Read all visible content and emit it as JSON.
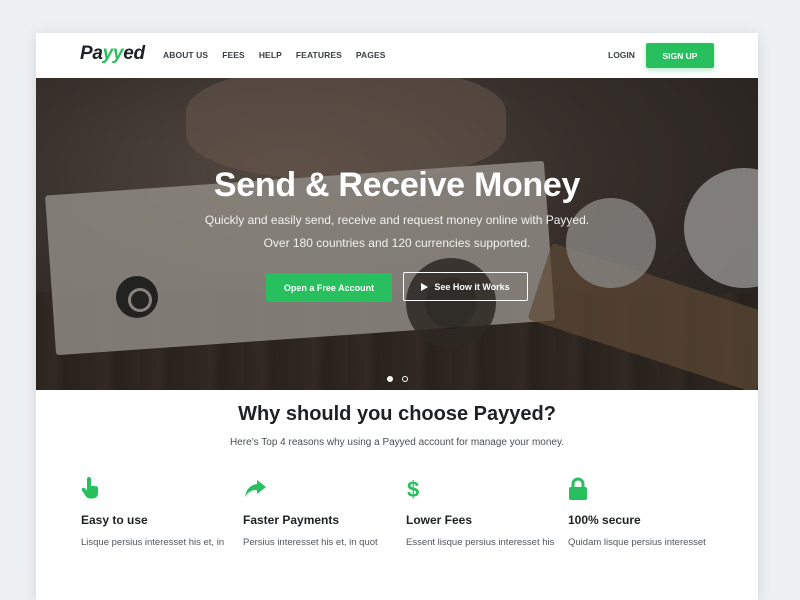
{
  "brand": {
    "logo_prefix": "Pa",
    "logo_accent": "yy",
    "logo_suffix": "ed",
    "accent_color": "#28c05f"
  },
  "nav": {
    "items": [
      {
        "label": "ABOUT US"
      },
      {
        "label": "FEES"
      },
      {
        "label": "HELP"
      },
      {
        "label": "FEATURES"
      },
      {
        "label": "PAGES"
      }
    ],
    "login_label": "LOGIN",
    "signup_label": "SIGN UP"
  },
  "hero": {
    "title": "Send & Receive Money",
    "subtitle_line1": "Quickly and easily send, receive and request money online with Payyed.",
    "subtitle_line2": "Over 180 countries and 120 currencies supported.",
    "primary_button": "Open a Free Account",
    "secondary_button": "See How it Works",
    "slides": 2,
    "active_slide": 1
  },
  "why": {
    "title": "Why should you choose Payyed?",
    "subtitle": "Here’s Top 4 reasons why using a Payyed account for manage your money.",
    "features": [
      {
        "icon": "hand-pointer-icon",
        "title": "Easy to use",
        "text": "Lisque persius interesset his et, in"
      },
      {
        "icon": "share-arrow-icon",
        "title": "Faster Payments",
        "text": "Persius interesset his et, in quot"
      },
      {
        "icon": "dollar-icon",
        "title": "Lower Fees",
        "text": "Essent lisque persius interesset his"
      },
      {
        "icon": "lock-icon",
        "title": "100% secure",
        "text": "Quidam lisque persius interesset"
      }
    ]
  }
}
